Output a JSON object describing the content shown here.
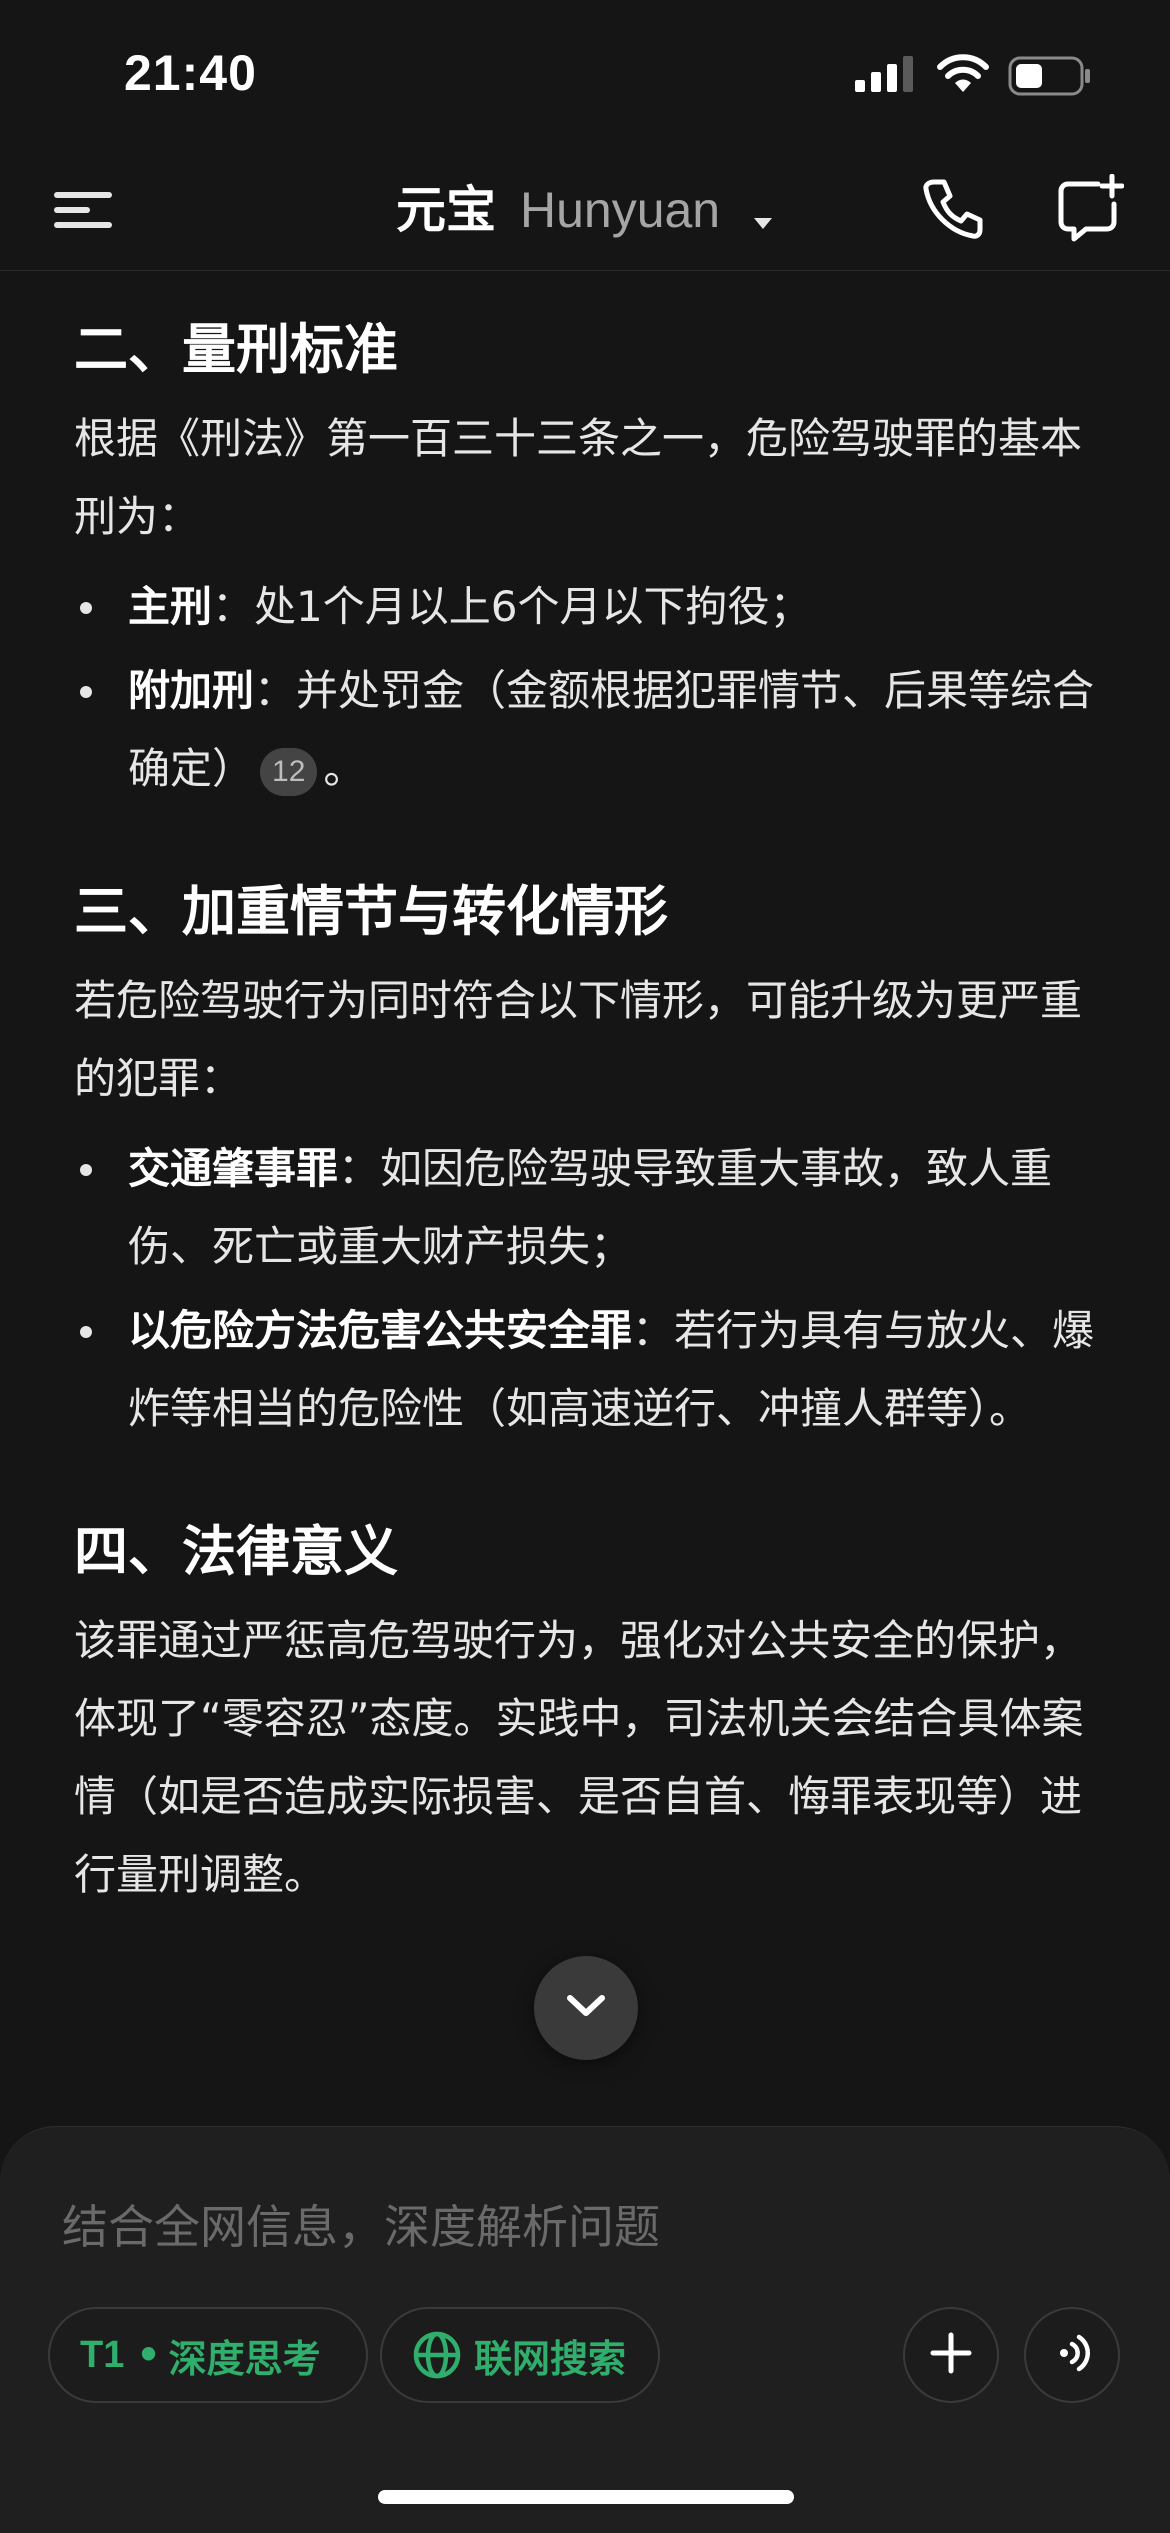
{
  "status_bar": {
    "time": "21:40",
    "icons": [
      "cellular-signal-icon",
      "wifi-icon",
      "battery-icon"
    ]
  },
  "nav": {
    "title_main": "元宝",
    "title_sub": "Hunyuan",
    "icons": [
      "menu-icon",
      "caret-down-icon",
      "phone-icon",
      "new-chat-icon"
    ]
  },
  "content": {
    "sections": [
      {
        "heading": "二、量刑标准",
        "paragraph": "根据《刑法》第一百三十三条之一，危险驾驶罪的基本刑为：",
        "bullets": [
          {
            "term": "主刑",
            "text": "：处1个月以上6个月以下拘役；",
            "cite": ""
          },
          {
            "term": "附加刑",
            "text": "：并处罚金（金额根据犯罪情节、后果等综合确定）",
            "cite": "12",
            "tail": "。"
          }
        ]
      },
      {
        "heading": "三、加重情节与转化情形",
        "paragraph": "若危险驾驶行为同时符合以下情形，可能升级为更严重的犯罪：",
        "bullets": [
          {
            "term": "交通肇事罪",
            "text": "：如因危险驾驶导致重大事故，致人重伤、死亡或重大财产损失；"
          },
          {
            "term": "以危险方法危害公共安全罪",
            "text": "：若行为具有与放火、爆炸等相当的危险性（如高速逆行、冲撞人群等）。"
          }
        ]
      },
      {
        "heading": "四、法律意义",
        "paragraph": "该罪通过严惩高危驾驶行为，强化对公共安全的保护，体现了“零容忍”态度。实践中，司法机关会结合具体案情（如是否造成实际损害、是否自首、悔罪表现等）进行量刑调整。"
      }
    ]
  },
  "scroll_button": {
    "icon": "chevron-down-icon"
  },
  "composer": {
    "placeholder": "结合全网信息，深度解析问题",
    "value": "",
    "chip_deep": {
      "model": "T1",
      "separator": "•",
      "label": "深度思考"
    },
    "chip_web": {
      "icon": "globe-icon",
      "label": "联网搜索"
    },
    "plus_icon": "plus-icon",
    "voice_icon": "voice-icon"
  },
  "colors": {
    "background": "#151515",
    "accent_green": "#2fae6c",
    "text": "#e6e6e6",
    "muted": "#a5a5a5"
  }
}
